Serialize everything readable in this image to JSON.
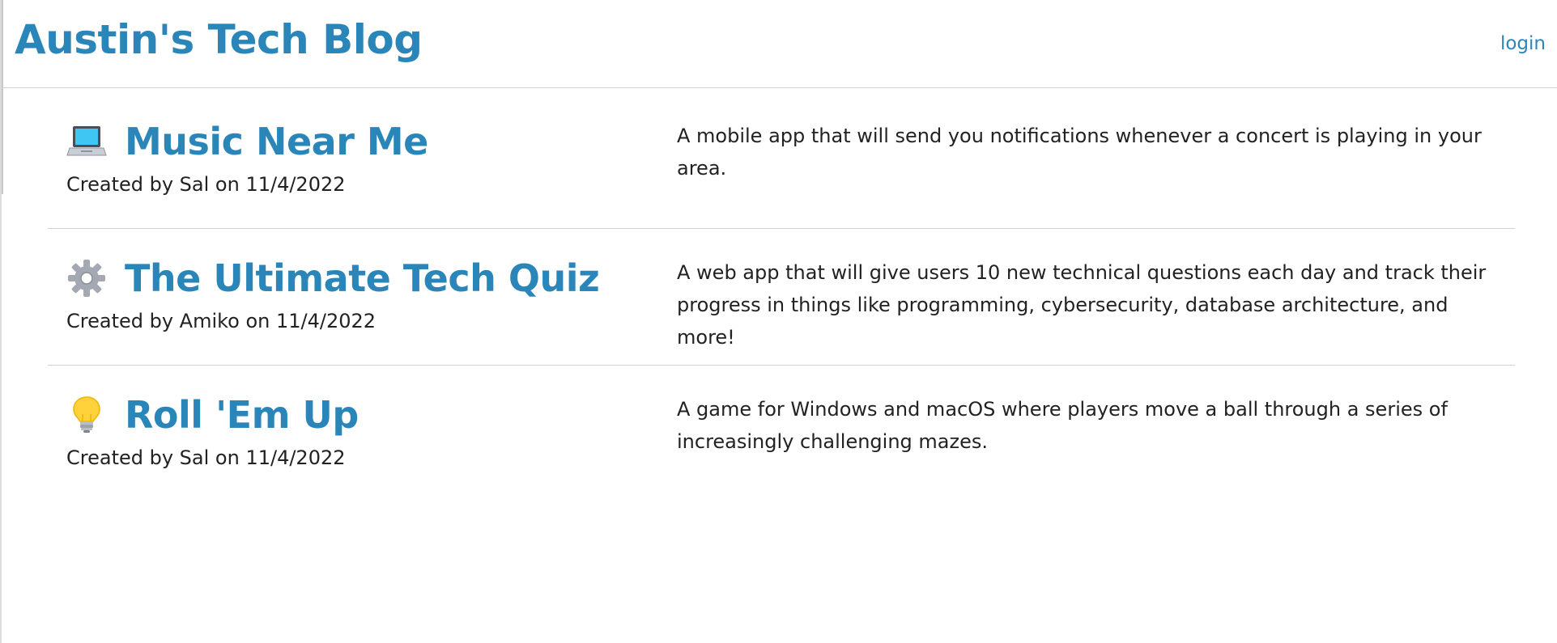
{
  "header": {
    "title": "Austin's Tech Blog",
    "login_label": "login"
  },
  "colors": {
    "accent": "#2a86b8",
    "text": "#222222",
    "divider": "#d0d0d0"
  },
  "posts": [
    {
      "icon": "laptop-icon",
      "title": "Music Near Me",
      "meta": "Created by Sal on 11/4/2022",
      "description": "A mobile app that will send you notifications whenever a concert is playing in your area."
    },
    {
      "icon": "gear-icon",
      "title": "The Ultimate Tech Quiz",
      "meta": "Created by Amiko on 11/4/2022",
      "description": "A web app that will give users 10 new technical questions each day and track their progress in things like programming, cybersecurity, database architecture, and more!"
    },
    {
      "icon": "light-bulb-icon",
      "title": "Roll 'Em Up",
      "meta": "Created by Sal on 11/4/2022",
      "description": "A game for Windows and macOS where players move a ball through a series of increasingly challenging mazes."
    }
  ]
}
